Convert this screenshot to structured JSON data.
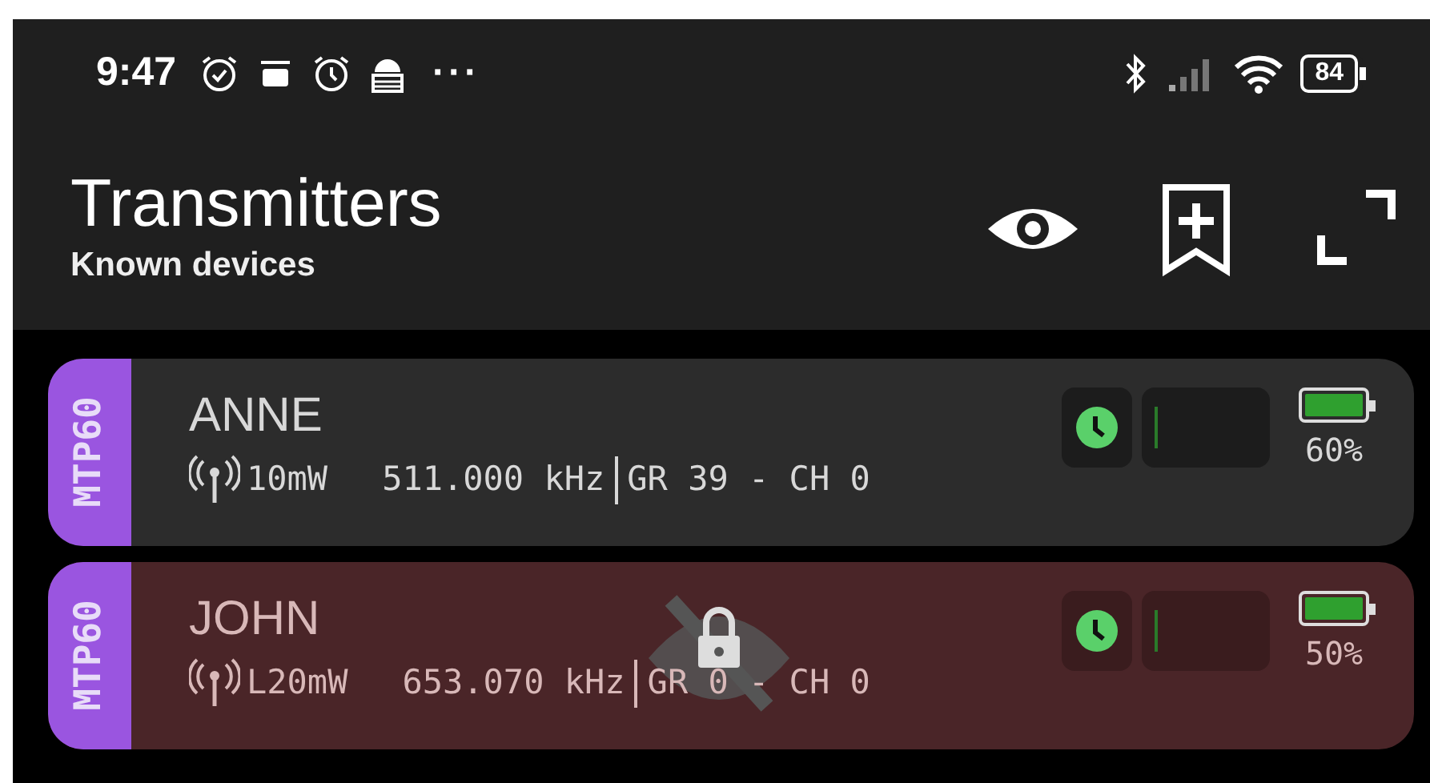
{
  "status_bar": {
    "time": "9:47",
    "more": "···",
    "battery": "84"
  },
  "header": {
    "title": "Transmitters",
    "subtitle": "Known devices"
  },
  "devices": [
    {
      "model": "MTP60",
      "name": "ANNE",
      "power": "10mW",
      "frequency": "511.000 kHz",
      "group": "GR 39 - CH 0",
      "hidden": false,
      "locked": false,
      "battery": {
        "reading": "60%"
      }
    },
    {
      "model": "MTP60",
      "name": "JOHN",
      "power": "L20mW",
      "frequency": "653.070 kHz",
      "group": "GR 0 - CH 0",
      "hidden": true,
      "locked": true,
      "battery": {
        "reading": "50%"
      }
    }
  ]
}
